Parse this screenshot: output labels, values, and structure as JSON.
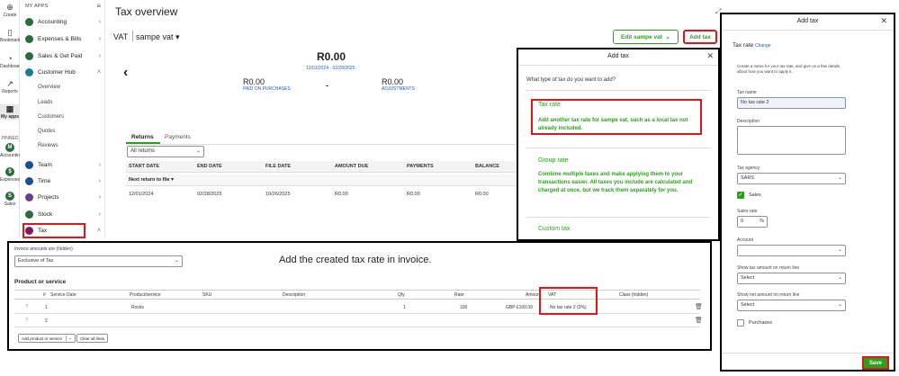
{
  "rail": {
    "items": [
      {
        "label": "Create",
        "icon": "plus-circle-icon"
      },
      {
        "label": "Bookmarks",
        "icon": "bookmark-icon"
      },
      {
        "label": "Dashboard",
        "icon": "dashboard-icon"
      },
      {
        "label": "Reports",
        "icon": "chart-icon"
      },
      {
        "label": "My apps",
        "icon": "apps-icon"
      },
      {
        "label": "PINNED",
        "icon": ""
      },
      {
        "label": "Accounting",
        "icon": "accounting-icon"
      },
      {
        "label": "Expenses",
        "icon": "expenses-icon"
      },
      {
        "label": "Sales",
        "icon": "sales-icon"
      }
    ]
  },
  "sidebar": {
    "heading": "MY APPS",
    "items": [
      {
        "label": "Accounting",
        "color": "#2d6a3e",
        "chevron": "›"
      },
      {
        "label": "Expenses & Bills",
        "color": "#2d6a3e",
        "chevron": "›"
      },
      {
        "label": "Sales & Get Paid",
        "color": "#2d6a3e",
        "chevron": "›"
      },
      {
        "label": "Customer Hub",
        "color": "#1f7a8c",
        "chevron": "˄"
      }
    ],
    "sub_items": [
      "Overview",
      "Leads",
      "Customers",
      "Quotes",
      "Reviews"
    ],
    "items2": [
      {
        "label": "Team",
        "color": "#1f4e8c",
        "chevron": "›"
      },
      {
        "label": "Time",
        "color": "#1f4e8c",
        "chevron": "›"
      },
      {
        "label": "Projects",
        "color": "#6a3e8c",
        "chevron": "›"
      },
      {
        "label": "Stock",
        "color": "#2d6a3e",
        "chevron": "›"
      },
      {
        "label": "Tax",
        "color": "#7a1f5c",
        "chevron": "˄"
      }
    ]
  },
  "main": {
    "title": "Tax overview",
    "vat_label": "VAT",
    "agency": "sampe vat",
    "edit_button": "Edit sampe vat",
    "add_tax_button": "Add tax",
    "amount": "R0.00",
    "period": "12/01/2024 - 02/28/2025",
    "paid_amount": "R0.00",
    "paid_label": "PAID ON PURCHASES",
    "minus": "-",
    "adj_amount": "R0.00",
    "adj_label": "ADJUSTMENTS",
    "tabs": [
      "Returns",
      "Payments"
    ],
    "filter": "All returns",
    "columns": [
      "START DATE",
      "END DATE",
      "FILE DATE",
      "AMOUNT DUE",
      "PAYMENTS",
      "BALANCE"
    ],
    "next_return": "Next return to file",
    "row": [
      "12/01/2024",
      "02/28/2025",
      "10/26/2025",
      "R0.00",
      "R0.00",
      "R0.00"
    ]
  },
  "add_tax_dialog": {
    "title": "Add tax",
    "question": "What type of tax do you want to add?",
    "options": [
      {
        "title": "Tax rate",
        "desc": "Add another tax rate for sampe vat, such as a local tax not already included."
      },
      {
        "title": "Group rate",
        "desc": "Combine multiple taxes and make applying them to your transactions easier. All taxes you include are calculated and charged at once, but we track them separately for you."
      },
      {
        "title": "Custom tax",
        "desc": ""
      }
    ]
  },
  "tax_rate_panel": {
    "title": "Add tax",
    "subtitle": "Tax rate",
    "change_link": "Change",
    "intro": "Create a name for your tax rate, and give us a few details about how you want to apply it.",
    "name_label": "Tax name",
    "name_value": "No tax rate 2",
    "desc_label": "Description",
    "agency_label": "Tax agency",
    "agency_value": "SARS",
    "sales_label": "Sales",
    "sales_rate_label": "Sales rate",
    "sales_rate_value": "0",
    "percent": "%",
    "account_label": "Account",
    "show_tax_label": "Show tax amount on return line",
    "show_tax_value": "Select",
    "show_net_label": "Show net amount on return line",
    "show_net_value": "Select",
    "purchases_label": "Purchases",
    "save_button": "Save"
  },
  "invoice": {
    "amounts_label": "Invoice amounts are (hidden)",
    "amounts_value": "Exclusive of Tax",
    "note": "Add the created tax rate in invoice.",
    "section": "Product or service",
    "columns": [
      "#",
      "Service Date",
      "Product/service",
      "SKU",
      "Description",
      "Qty",
      "Rate",
      "Amount",
      "VAT",
      "Class (hidden)"
    ],
    "rows": [
      {
        "num": "1",
        "product": "Rocks",
        "qty": "1",
        "rate": "100",
        "amount": "GBP £100.00",
        "vat": "No tax rate 2 (0%)"
      },
      {
        "num": "2",
        "product": "",
        "qty": "",
        "rate": "",
        "amount": "",
        "vat": ""
      }
    ],
    "add_button": "Add product or service",
    "clear_button": "Clear all lines"
  },
  "colors": {
    "accent": "#2ca01c",
    "highlight": "#e0161b"
  }
}
